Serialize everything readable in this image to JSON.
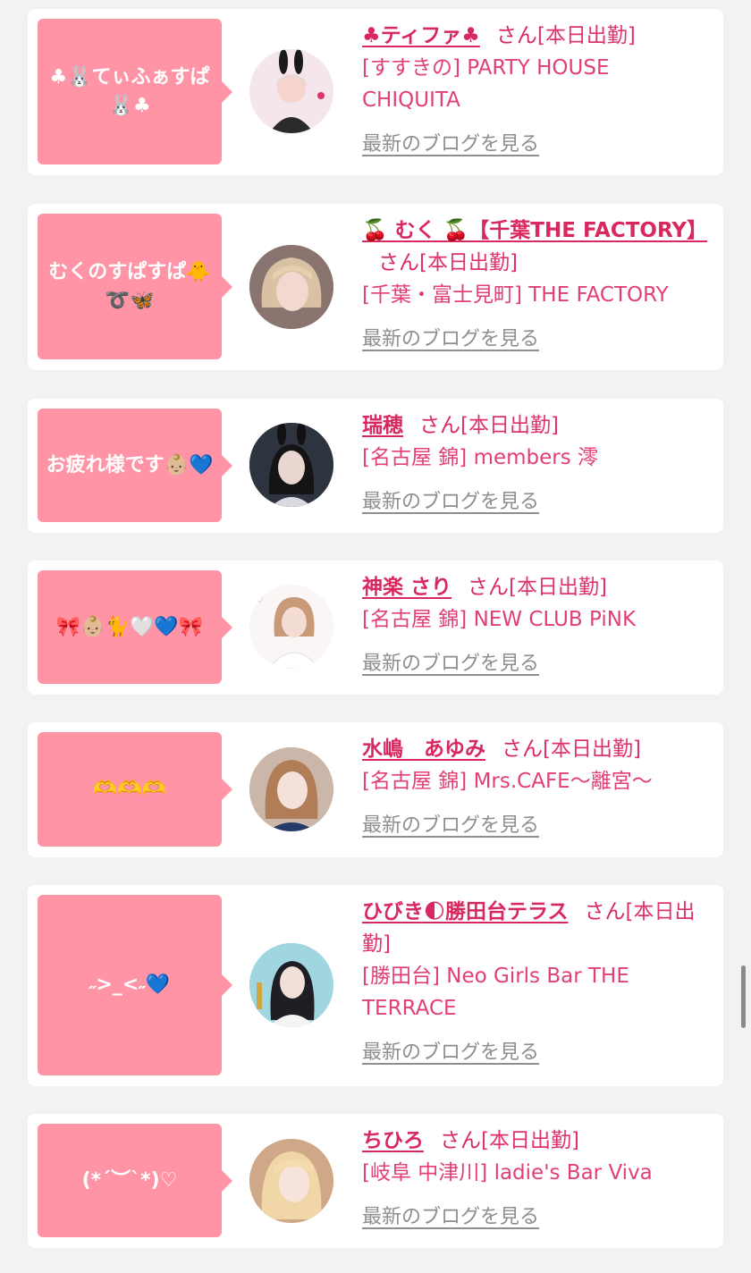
{
  "cards": [
    {
      "message": "♣🐰てぃふぁすぱ🐰♣",
      "name": "♣ティファ♣",
      "san": "さん",
      "status": "[本日出勤]",
      "store": "[すすきの] PARTY HOUSE CHIQUITA",
      "blog_link": "最新のブログを見る",
      "colors": {
        "bg": "#f3e2ea"
      }
    },
    {
      "message": "むくのすぱすぱ🐥➰🦋",
      "name": "🍒 むく 🍒【千葉THE FACTORY】",
      "san": "さん",
      "status": "[本日出勤]",
      "store": "[千葉・富士見町] THE FACTORY",
      "blog_link": "最新のブログを見る",
      "colors": {
        "bg": "#b79e97"
      }
    },
    {
      "message": "お疲れ様です👶🏼💙",
      "name": "瑞穂",
      "san": "さん",
      "status": "[本日出勤]",
      "store": "[名古屋 錦] members 澪",
      "blog_link": "最新のブログを見る",
      "colors": {
        "bg": "#3a3f4c"
      }
    },
    {
      "message": "🎀👶🏼🐈🤍💙🎀",
      "name": "神楽 さり",
      "san": "さん",
      "status": "[本日出勤]",
      "store": "[名古屋 錦] NEW CLUB PiNK",
      "blog_link": "最新のブログを見る",
      "colors": {
        "bg": "#f6f0ee"
      }
    },
    {
      "message": "🫶🫶🫶",
      "name": "水嶋　あゆみ",
      "san": "さん",
      "status": "[本日出勤]",
      "store": "[名古屋 錦] Mrs.CAFE〜離宮〜",
      "blog_link": "最新のブログを見る",
      "colors": {
        "bg": "#c9b1a4"
      }
    },
    {
      "message": "˶>_<˶💙",
      "name": "ひびき🌓勝田台テラス",
      "san": "さん",
      "status": "[本日出勤]",
      "store": "[勝田台] Neo Girls Bar THE TERRACE",
      "blog_link": "最新のブログを見る",
      "colors": {
        "bg": "#a8dbe4"
      }
    },
    {
      "message": "(*´︶`*)♡",
      "name": "ちひろ",
      "san": "さん",
      "status": "[本日出勤]",
      "store": "[岐阜 中津川] ladie's Bar Viva",
      "blog_link": "最新のブログを見る",
      "colors": {
        "bg": "#d7b596"
      }
    }
  ]
}
